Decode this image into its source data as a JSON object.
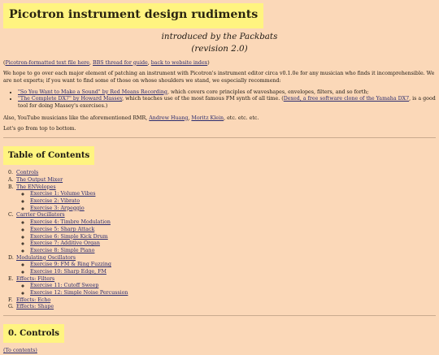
{
  "title": "Picotron instrument design rudiments",
  "subtitle_line1": "introduced by the Packbats",
  "subtitle_line2": "(revision 2.0)",
  "links_line": {
    "open": "(",
    "link1": "Picotron-formatted text file here",
    "sep1": ", ",
    "link2": "BBS thread for guide",
    "sep2": ", ",
    "link3": "back to website index",
    "close": ")"
  },
  "intro": "We hope to go over each major element of patching an instrument with Picotron's instrument editor circa v0.1.0e for any musician who finds it incomprehensible. We are not experts; if you want to find some of those on whose shoulders we stand, we especially recommend:",
  "recommendations": [
    {
      "link": "\"So You Want to Make a Sound\" by Red Means Recording",
      "text": ", which covers core principles of waveshapes, envelopes, filters, and so forth;"
    },
    {
      "link": "\"The Complete DX7\" by Howard Massey",
      "text": ", which teaches use of the most famous FM synth of all time. (",
      "link2": "Dexed, a free software clone of the Yamaha DX7",
      "text2": ", is a good tool for doing Massey's exercises.)"
    }
  ],
  "also": {
    "pre": "Also, YouTube musicians like the aforementioned RMR, ",
    "link1": "Andrew Huang",
    "sep": ", ",
    "link2": "Moritz Klein",
    "post": ", etc. etc. etc."
  },
  "top_to_bottom": "Let's go from top to bottom.",
  "toc_heading": "Table of Contents",
  "toc": [
    {
      "marker": "0.",
      "label": "Controls",
      "sub": []
    },
    {
      "marker": "A.",
      "label": "The Output Mixer",
      "sub": []
    },
    {
      "marker": "B.",
      "label": "The ENVelopes",
      "sub": [
        "Exercise 1: Volume Vibes",
        "Exercise 2: Vibrato",
        "Exercise 3: Arpeggio"
      ]
    },
    {
      "marker": "C.",
      "label": "Carrier Oscillators",
      "sub": [
        "Exercise 4: Timbre Modulation",
        "Exercise 5: Sharp Attack",
        "Exercise 6: Simple Kick Drum",
        "Exercise 7: Additive Organ",
        "Exercise 8: Simple Piano"
      ]
    },
    {
      "marker": "D.",
      "label": "Modulating Oscillators",
      "sub": [
        "Exercise 9: FM & Ring Fuzzing",
        "Exercise 10: Sharp Edge, FM"
      ]
    },
    {
      "marker": "E.",
      "label": "Effects: Filters",
      "sub": [
        "Exercise 11: Cutoff Sweep",
        "Exercise 12: Simple Noise Percussion"
      ]
    },
    {
      "marker": "F.",
      "label": "Effects: Echo",
      "sub": []
    },
    {
      "marker": "G.",
      "label": "Effects: Shape",
      "sub": []
    }
  ],
  "section0_heading": "0. Controls",
  "to_contents": "(To contents)"
}
